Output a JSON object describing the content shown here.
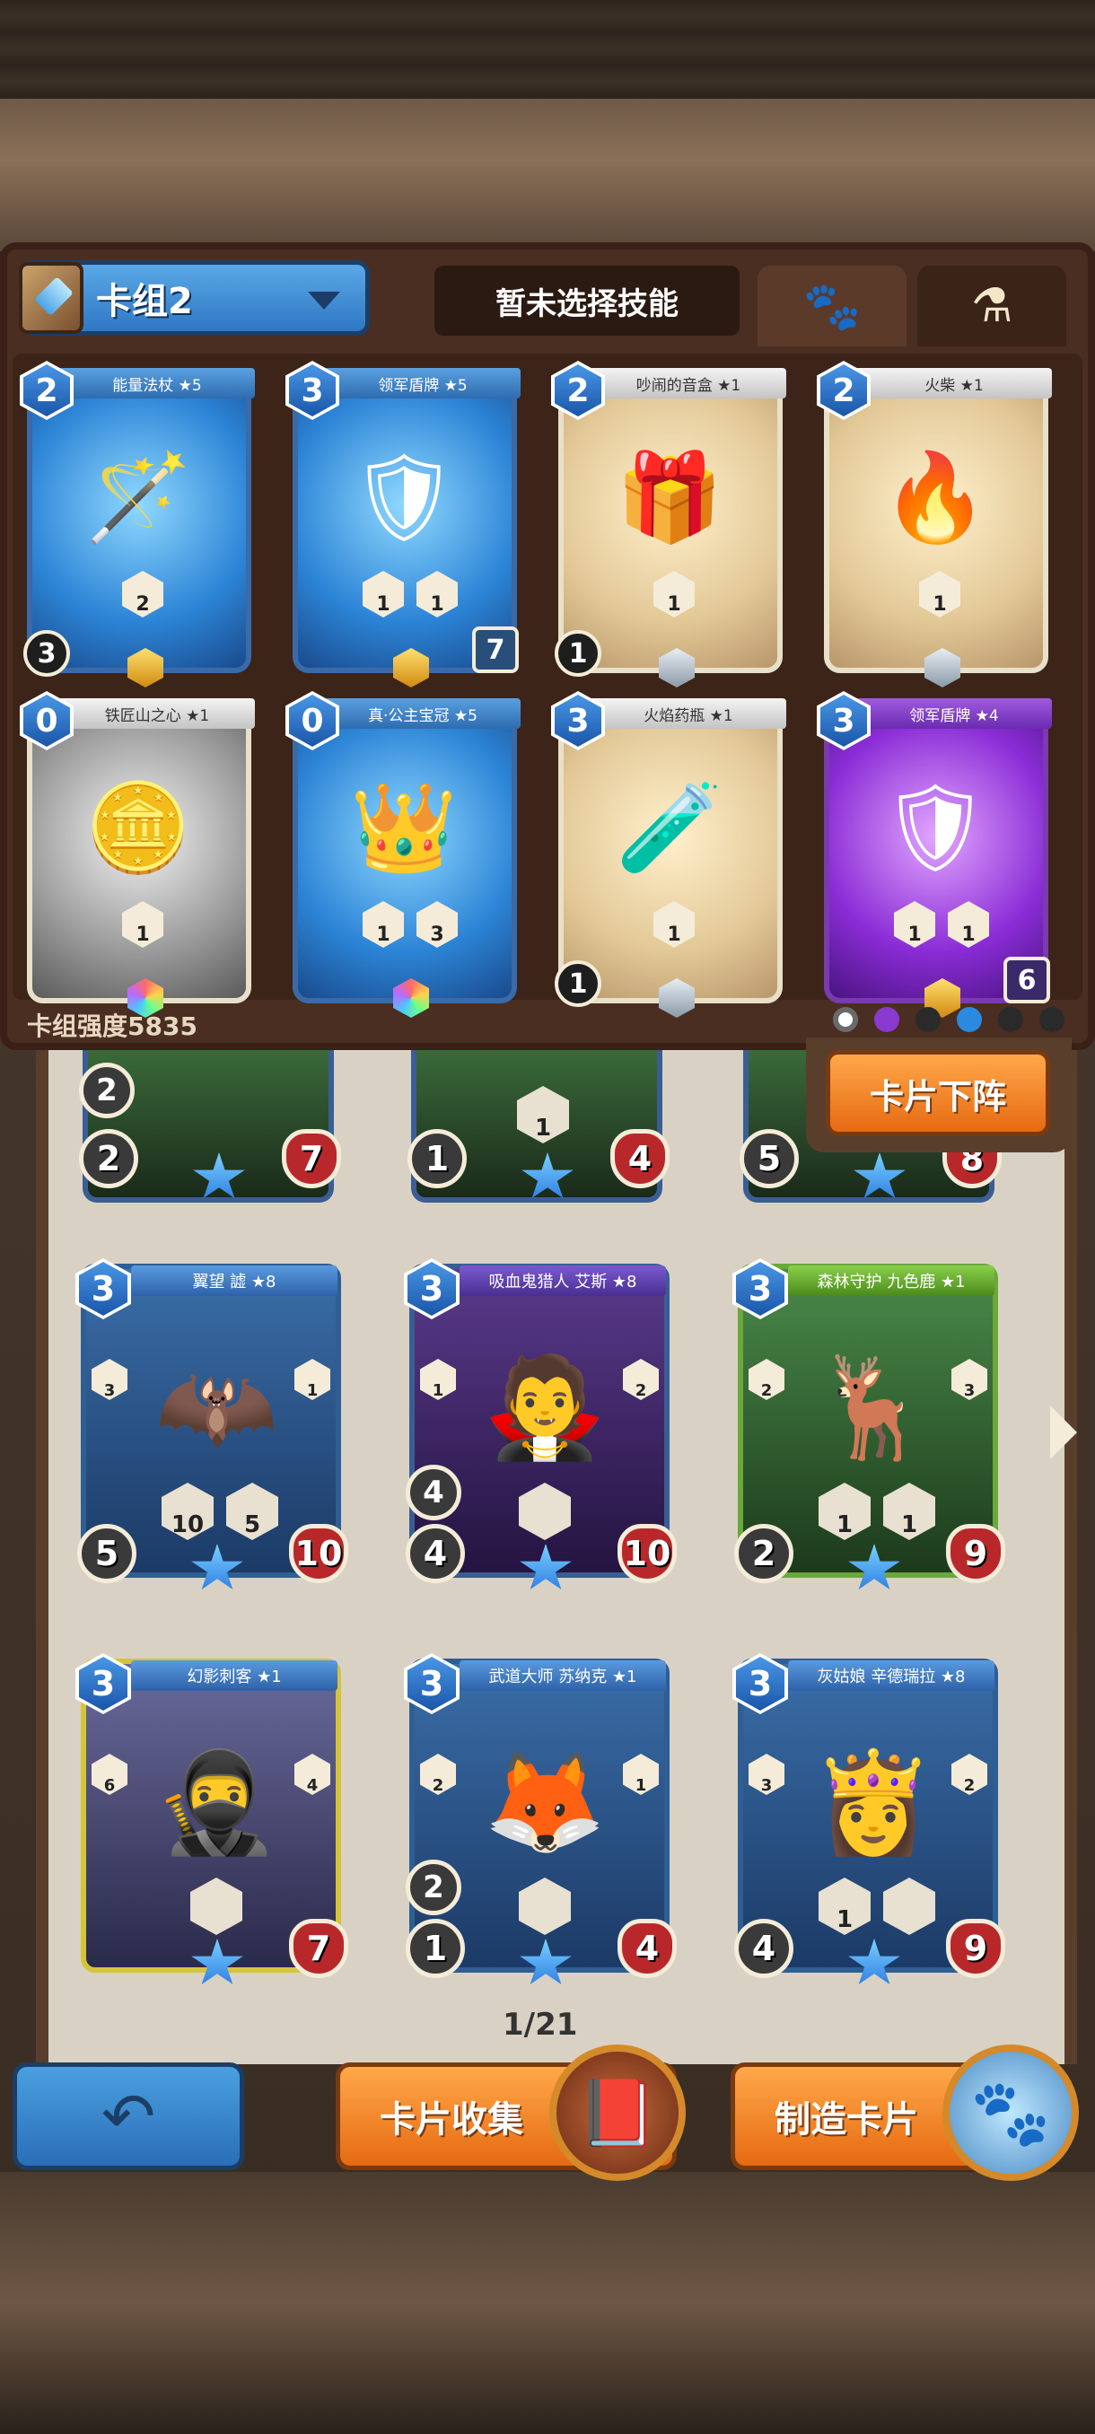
{
  "header": {
    "deck_name": "卡组2",
    "skill_label": "暂未选择技能",
    "tabs": [
      {
        "name": "paw-tab",
        "icon": "paw-icon"
      },
      {
        "name": "potion-tab",
        "icon": "potion-icon"
      }
    ]
  },
  "deck_cards": [
    {
      "name": "能量法杖 ★5",
      "cost": "2",
      "type": "blue",
      "stats": [
        "2"
      ],
      "bl": "3",
      "br": "",
      "gem": "gold"
    },
    {
      "name": "领军盾牌 ★5",
      "cost": "3",
      "type": "blue",
      "stats": [
        "1",
        "1"
      ],
      "bl": "",
      "br": "7",
      "gem": "gold"
    },
    {
      "name": "吵闹的音盒 ★1",
      "cost": "2",
      "type": "tan",
      "stats": [
        "1"
      ],
      "bl": "1",
      "br": "",
      "gem": "silver"
    },
    {
      "name": "火柴 ★1",
      "cost": "2",
      "type": "tan",
      "stats": [
        "1"
      ],
      "bl": "",
      "br": "",
      "gem": "silver"
    },
    {
      "name": "铁匠山之心 ★1",
      "cost": "0",
      "type": "grey",
      "stats": [
        "1"
      ],
      "bl": "",
      "br": "",
      "gem": "rainbow"
    },
    {
      "name": "真·公主宝冠 ★5",
      "cost": "0",
      "type": "blue",
      "stats": [
        "1",
        "3"
      ],
      "bl": "",
      "br": "",
      "gem": "rainbow"
    },
    {
      "name": "火焰药瓶 ★1",
      "cost": "3",
      "type": "tan",
      "stats": [
        "1"
      ],
      "bl": "1",
      "br": "",
      "gem": "silver"
    },
    {
      "name": "领军盾牌 ★4",
      "cost": "3",
      "type": "purple",
      "stats": [
        "1",
        "1"
      ],
      "bl": "",
      "br": "6",
      "gem": "gold"
    }
  ],
  "deck_strength": "卡组强度5835",
  "unequip_label": "卡片下阵",
  "partial_cards": [
    {
      "top": "2",
      "atk": "2",
      "mid": "",
      "hp": "7"
    },
    {
      "top": "",
      "atk": "1",
      "mid": "1",
      "hp": "4"
    },
    {
      "top": "",
      "atk": "5",
      "mid": "",
      "hp": "8"
    }
  ],
  "collection_cards": [
    {
      "name": "翼望 譃 ★8",
      "cost": "3",
      "type": "blue",
      "left": "3",
      "right": "1",
      "mids": [
        "10",
        "5"
      ],
      "extra": "",
      "atk": "5",
      "hp": "10"
    },
    {
      "name": "吸血鬼猎人 艾斯 ★8",
      "cost": "3",
      "type": "purple",
      "left": "1",
      "right": "2",
      "mids": [
        ""
      ],
      "extra": "4",
      "atk": "4",
      "hp": "10"
    },
    {
      "name": "森林守护 九色鹿 ★1",
      "cost": "3",
      "type": "green",
      "left": "2",
      "right": "3",
      "mids": [
        "1",
        "1"
      ],
      "extra": "",
      "atk": "2",
      "hp": "9"
    },
    {
      "name": "幻影刺客 ★1",
      "cost": "3",
      "type": "yellow",
      "left": "6",
      "right": "4",
      "mids": [
        ""
      ],
      "extra": "",
      "atk": "",
      "hp": "7"
    },
    {
      "name": "武道大师 苏纳克 ★1",
      "cost": "3",
      "type": "blue",
      "left": "2",
      "right": "1",
      "mids": [
        ""
      ],
      "extra": "2",
      "atk": "1",
      "hp": "4"
    },
    {
      "name": "灰姑娘 辛德瑞拉 ★8",
      "cost": "3",
      "type": "blue",
      "left": "3",
      "right": "2",
      "mids": [
        "1",
        ""
      ],
      "extra": "",
      "atk": "4",
      "hp": "9"
    }
  ],
  "page_indicator": "1/21",
  "buttons": {
    "collect": "卡片收集",
    "craft": "制造卡片"
  }
}
